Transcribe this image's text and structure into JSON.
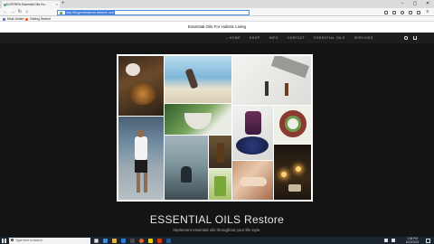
{
  "browser": {
    "tab_title": "DoTERRA Essential Oils Ho...",
    "tab_close": "×",
    "new_tab": "+",
    "url": "http://blogrenteriacom.anlstore.com",
    "bookmarks": [
      "Most Visited",
      "Getting Started"
    ],
    "window_controls": [
      "–",
      "▢",
      "✕"
    ],
    "nav_glyphs": {
      "back": "←",
      "forward": "→",
      "reload": "↻",
      "home": "⌂"
    }
  },
  "site": {
    "title": "Essential Oils For Holistic Living",
    "menu": [
      "HOME",
      "SHOP",
      "INFO",
      "CONTACT",
      "ESSENTIAL OILS",
      "SERVICES"
    ],
    "hero_title": "ESSENTIAL OILS Restore",
    "hero_subtitle": "Implement essential oils throughout your life style."
  },
  "taskbar": {
    "search_placeholder": "Type here to search",
    "time": "1:36 PM",
    "date": "6/13/2019"
  },
  "colors": {
    "page_bg": "#141414",
    "nav_bg": "#1d1d1d",
    "url_highlight": "#3b76d8",
    "taskbar_bg": "#1b2530"
  }
}
